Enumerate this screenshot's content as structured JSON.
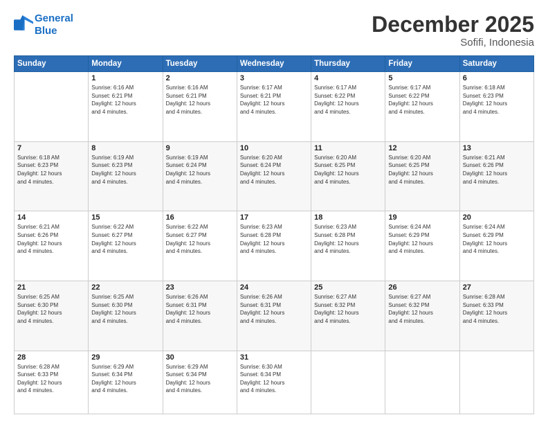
{
  "header": {
    "logo_line1": "General",
    "logo_line2": "Blue",
    "month": "December 2025",
    "location": "Sofifi, Indonesia"
  },
  "weekdays": [
    "Sunday",
    "Monday",
    "Tuesday",
    "Wednesday",
    "Thursday",
    "Friday",
    "Saturday"
  ],
  "weeks": [
    [
      {
        "day": "",
        "info": ""
      },
      {
        "day": "1",
        "info": "Sunrise: 6:16 AM\nSunset: 6:21 PM\nDaylight: 12 hours\nand 4 minutes."
      },
      {
        "day": "2",
        "info": "Sunrise: 6:16 AM\nSunset: 6:21 PM\nDaylight: 12 hours\nand 4 minutes."
      },
      {
        "day": "3",
        "info": "Sunrise: 6:17 AM\nSunset: 6:21 PM\nDaylight: 12 hours\nand 4 minutes."
      },
      {
        "day": "4",
        "info": "Sunrise: 6:17 AM\nSunset: 6:22 PM\nDaylight: 12 hours\nand 4 minutes."
      },
      {
        "day": "5",
        "info": "Sunrise: 6:17 AM\nSunset: 6:22 PM\nDaylight: 12 hours\nand 4 minutes."
      },
      {
        "day": "6",
        "info": "Sunrise: 6:18 AM\nSunset: 6:23 PM\nDaylight: 12 hours\nand 4 minutes."
      }
    ],
    [
      {
        "day": "7",
        "info": "Sunrise: 6:18 AM\nSunset: 6:23 PM\nDaylight: 12 hours\nand 4 minutes."
      },
      {
        "day": "8",
        "info": "Sunrise: 6:19 AM\nSunset: 6:23 PM\nDaylight: 12 hours\nand 4 minutes."
      },
      {
        "day": "9",
        "info": "Sunrise: 6:19 AM\nSunset: 6:24 PM\nDaylight: 12 hours\nand 4 minutes."
      },
      {
        "day": "10",
        "info": "Sunrise: 6:20 AM\nSunset: 6:24 PM\nDaylight: 12 hours\nand 4 minutes."
      },
      {
        "day": "11",
        "info": "Sunrise: 6:20 AM\nSunset: 6:25 PM\nDaylight: 12 hours\nand 4 minutes."
      },
      {
        "day": "12",
        "info": "Sunrise: 6:20 AM\nSunset: 6:25 PM\nDaylight: 12 hours\nand 4 minutes."
      },
      {
        "day": "13",
        "info": "Sunrise: 6:21 AM\nSunset: 6:26 PM\nDaylight: 12 hours\nand 4 minutes."
      }
    ],
    [
      {
        "day": "14",
        "info": "Sunrise: 6:21 AM\nSunset: 6:26 PM\nDaylight: 12 hours\nand 4 minutes."
      },
      {
        "day": "15",
        "info": "Sunrise: 6:22 AM\nSunset: 6:27 PM\nDaylight: 12 hours\nand 4 minutes."
      },
      {
        "day": "16",
        "info": "Sunrise: 6:22 AM\nSunset: 6:27 PM\nDaylight: 12 hours\nand 4 minutes."
      },
      {
        "day": "17",
        "info": "Sunrise: 6:23 AM\nSunset: 6:28 PM\nDaylight: 12 hours\nand 4 minutes."
      },
      {
        "day": "18",
        "info": "Sunrise: 6:23 AM\nSunset: 6:28 PM\nDaylight: 12 hours\nand 4 minutes."
      },
      {
        "day": "19",
        "info": "Sunrise: 6:24 AM\nSunset: 6:29 PM\nDaylight: 12 hours\nand 4 minutes."
      },
      {
        "day": "20",
        "info": "Sunrise: 6:24 AM\nSunset: 6:29 PM\nDaylight: 12 hours\nand 4 minutes."
      }
    ],
    [
      {
        "day": "21",
        "info": "Sunrise: 6:25 AM\nSunset: 6:30 PM\nDaylight: 12 hours\nand 4 minutes."
      },
      {
        "day": "22",
        "info": "Sunrise: 6:25 AM\nSunset: 6:30 PM\nDaylight: 12 hours\nand 4 minutes."
      },
      {
        "day": "23",
        "info": "Sunrise: 6:26 AM\nSunset: 6:31 PM\nDaylight: 12 hours\nand 4 minutes."
      },
      {
        "day": "24",
        "info": "Sunrise: 6:26 AM\nSunset: 6:31 PM\nDaylight: 12 hours\nand 4 minutes."
      },
      {
        "day": "25",
        "info": "Sunrise: 6:27 AM\nSunset: 6:32 PM\nDaylight: 12 hours\nand 4 minutes."
      },
      {
        "day": "26",
        "info": "Sunrise: 6:27 AM\nSunset: 6:32 PM\nDaylight: 12 hours\nand 4 minutes."
      },
      {
        "day": "27",
        "info": "Sunrise: 6:28 AM\nSunset: 6:33 PM\nDaylight: 12 hours\nand 4 minutes."
      }
    ],
    [
      {
        "day": "28",
        "info": "Sunrise: 6:28 AM\nSunset: 6:33 PM\nDaylight: 12 hours\nand 4 minutes."
      },
      {
        "day": "29",
        "info": "Sunrise: 6:29 AM\nSunset: 6:34 PM\nDaylight: 12 hours\nand 4 minutes."
      },
      {
        "day": "30",
        "info": "Sunrise: 6:29 AM\nSunset: 6:34 PM\nDaylight: 12 hours\nand 4 minutes."
      },
      {
        "day": "31",
        "info": "Sunrise: 6:30 AM\nSunset: 6:34 PM\nDaylight: 12 hours\nand 4 minutes."
      },
      {
        "day": "",
        "info": ""
      },
      {
        "day": "",
        "info": ""
      },
      {
        "day": "",
        "info": ""
      }
    ]
  ]
}
